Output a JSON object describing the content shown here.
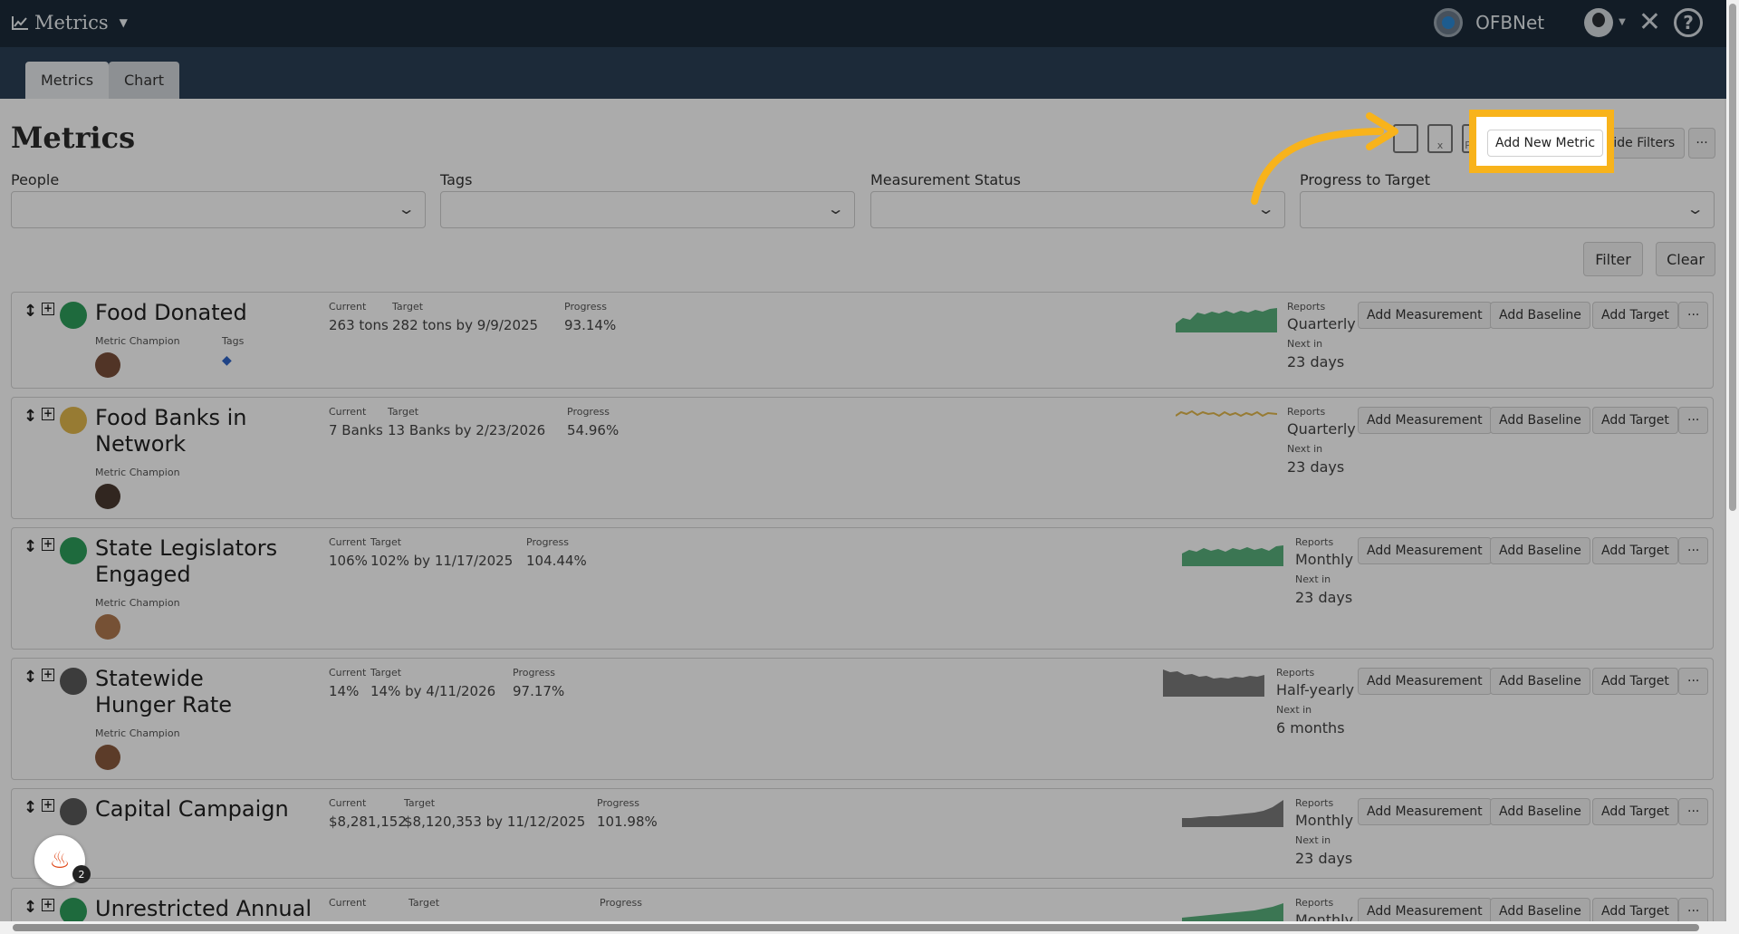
{
  "topbar": {
    "app_menu": "Metrics",
    "org_name": "OFBNet"
  },
  "tabs": [
    {
      "label": "Metrics"
    },
    {
      "label": "Chart"
    }
  ],
  "page": {
    "title": "Metrics"
  },
  "toolbar": {
    "add_new_metric": "Add New Metric",
    "hide_filters": "Hide Filters",
    "more": "···"
  },
  "filters": [
    {
      "label": "People"
    },
    {
      "label": "Tags"
    },
    {
      "label": "Measurement Status"
    },
    {
      "label": "Progress to Target"
    }
  ],
  "filter_actions": {
    "filter": "Filter",
    "clear": "Clear"
  },
  "labels": {
    "current": "Current",
    "target": "Target",
    "progress": "Progress",
    "metric_champion": "Metric Champion",
    "tags": "Tags",
    "reports": "Reports",
    "next_in": "Next in",
    "add_measurement": "Add Measurement",
    "add_baseline": "Add Baseline",
    "add_target": "Add Target",
    "more": "···"
  },
  "colors": {
    "green": "#2e9e5b",
    "yellow": "#e2b84d",
    "gray": "#5a5a5a",
    "highlight": "#f8b31b",
    "topbar": "#1c2b3a"
  },
  "metrics": [
    {
      "name": "Food Donated",
      "status": "green",
      "current": "263 tons",
      "target": "282 tons by 9/9/2025",
      "progress": "93.14%",
      "reports": "Quarterly",
      "next_in": "23 days"
    },
    {
      "name": "Food Banks in Network",
      "status": "yellow",
      "current": "7 Banks",
      "target": "13 Banks by 2/23/2026",
      "progress": "54.96%",
      "reports": "Quarterly",
      "next_in": "23 days"
    },
    {
      "name": "State Legislators Engaged",
      "status": "green",
      "current": "106%",
      "target": "102% by 11/17/2025",
      "progress": "104.44%",
      "reports": "Monthly",
      "next_in": "23 days"
    },
    {
      "name": "Statewide Hunger Rate",
      "status": "gray",
      "current": "14%",
      "target": "14% by 4/11/2026",
      "progress": "97.17%",
      "reports": "Half-yearly",
      "next_in": "6 months"
    },
    {
      "name": "Capital Campaign",
      "status": "gray",
      "current": "$8,281,152",
      "target": "$8,120,353 by 11/12/2025",
      "progress": "101.98%",
      "reports": "Monthly",
      "next_in": "23 days"
    },
    {
      "name": "Unrestricted Annual",
      "status": "green",
      "current": "",
      "target": "",
      "progress": "",
      "reports": "Monthly",
      "next_in": ""
    }
  ],
  "badge": {
    "count": "2"
  }
}
